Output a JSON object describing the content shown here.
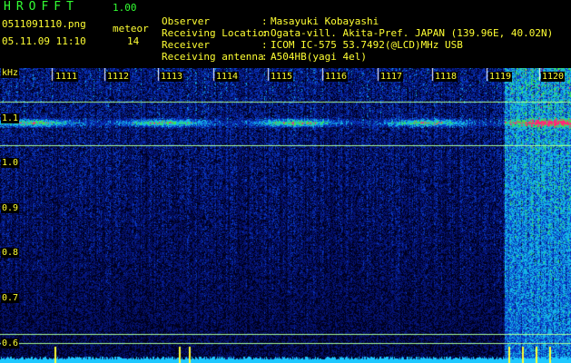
{
  "header": {
    "logo": "HROFFT",
    "version": "1.00",
    "filename": "0511091110.png",
    "datetime": "05.11.09 11:10",
    "mode": "meteor",
    "count": "14"
  },
  "info": [
    {
      "key": "Observer",
      "value": "Masayuki Kobayashi"
    },
    {
      "key": "Receiving Location",
      "value": "Ogata-vill. Akita-Pref. JAPAN (139.96E, 40.02N)"
    },
    {
      "key": "Receiver",
      "value": "ICOM IC-575 53.7492(@LCD)MHz USB"
    },
    {
      "key": "Receiving antenna",
      "value": "A504HB(yagi 4el)"
    }
  ],
  "spectrogram": {
    "y_unit": "kHz",
    "y_ticks": [
      "1.1",
      "1.0",
      "0.9",
      "0.8",
      "0.7",
      "0.6"
    ],
    "time_labels": [
      "1111",
      "1112",
      "1113",
      "1114",
      "1115",
      "1116",
      "1117",
      "1118",
      "1119",
      "1120"
    ]
  },
  "colors": {
    "text_yellow": "#ffff33",
    "logo_green": "#33ff33",
    "grid_line": "#aaff99",
    "tick_white": "#ffffff",
    "background": "#000000"
  }
}
